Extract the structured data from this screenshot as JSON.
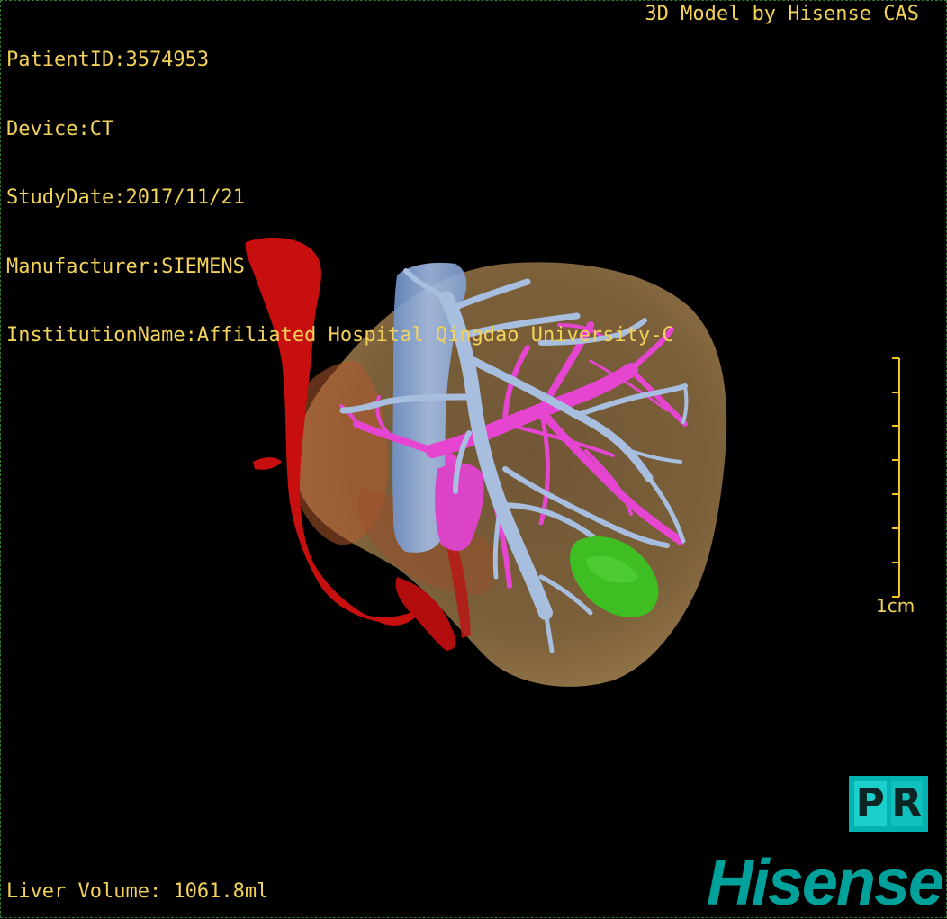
{
  "header": {
    "patient_id": "PatientID:3574953",
    "device": "Device:CT",
    "study_date": "StudyDate:2017/11/21",
    "manufacturer": "Manufacturer:SIEMENS",
    "institution": "InstitutionName:Affiliated Hospital Qingdao University-C",
    "model_credit": "3D Model by Hisense CAS"
  },
  "footer": {
    "liver_volume": "Liver Volume: 1061.8ml"
  },
  "scale_bar": {
    "label": "1cm",
    "color": "#f2c22a"
  },
  "logos": {
    "pr_letters": [
      "P",
      "R"
    ],
    "brand": "Hisense",
    "brand_color": "#00a19a"
  },
  "colors": {
    "overlay_text": "#f2d25a",
    "background": "#000000",
    "liver": "#8a6a3e",
    "artery": "#d11313",
    "portal_vein": "#e64fd2",
    "hepatic_vein": "#a9bfe0",
    "vena_cava": "#7fa3d8",
    "lesion": "#3fbf2a"
  },
  "view": {
    "structures": [
      "liver",
      "hepatic-artery",
      "portal-vein",
      "hepatic-vein",
      "inferior-vena-cava",
      "lesion"
    ]
  }
}
